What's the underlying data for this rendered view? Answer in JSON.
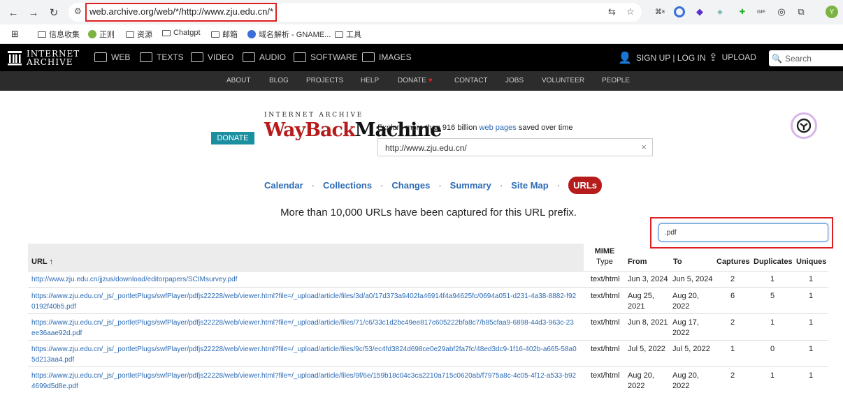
{
  "browser": {
    "url": "web.archive.org/web/*/http://www.zju.edu.cn/*",
    "profile_initial": "Y",
    "ext_badge": "8",
    "ext_gif": "GIF",
    "bookmarks": [
      "信息收集",
      "正则",
      "资源",
      "Chatgpt",
      "邮箱",
      "域名解析 - GNAME...",
      "工具"
    ]
  },
  "ia_nav": {
    "logo_line1": "INTERNET",
    "logo_line2": "ARCHIVE",
    "items": [
      "WEB",
      "TEXTS",
      "VIDEO",
      "AUDIO",
      "SOFTWARE",
      "IMAGES"
    ],
    "signup": "SIGN UP | LOG IN",
    "upload": "UPLOAD",
    "search_placeholder": "Search"
  },
  "ia_subnav": [
    "ABOUT",
    "BLOG",
    "PROJECTS",
    "HELP",
    "DONATE",
    "CONTACT",
    "JOBS",
    "VOLUNTEER",
    "PEOPLE"
  ],
  "wayback": {
    "donate_label": "DONATE",
    "logo_top": "INTERNET ARCHIVE",
    "logo_way": "WayBack",
    "logo_machine": "Machine",
    "explore_pre": "Explore more than 916 billion",
    "explore_link": "web pages",
    "explore_post": "saved over time",
    "search_value": "http://www.zju.edu.cn/",
    "clear": "×"
  },
  "tabs": [
    "Calendar",
    "Collections",
    "Changes",
    "Summary",
    "Site Map",
    "URLs"
  ],
  "tab_separator": "·",
  "summary_text": "More than 10,000 URLs have been captured for this URL prefix.",
  "filter_value": ".pdf",
  "table": {
    "headers": {
      "url": "URL ↑",
      "mime_line1": "MIME",
      "mime_line2": "Type",
      "from": "From",
      "to": "To",
      "captures": "Captures",
      "duplicates": "Duplicates",
      "uniques": "Uniques"
    },
    "rows": [
      {
        "url": "http://www.zju.edu.cn/jjzus/download/editorpapers/SCIMsurvey.pdf",
        "mime": "text/html",
        "from": "Jun 3, 2024",
        "to": "Jun 5, 2024",
        "captures": "2",
        "duplicates": "1",
        "uniques": "1"
      },
      {
        "url": "https://www.zju.edu.cn/_js/_portletPlugs/swfPlayer/pdfjs22228/web/viewer.html?file=/_upload/article/files/3d/a0/17d373a9402fa46914f4a94625fc/0694a051-d231-4a38-8882-f920192f40b5.pdf",
        "mime": "text/html",
        "from": "Aug 25, 2021",
        "to": "Aug 20, 2022",
        "captures": "6",
        "duplicates": "5",
        "uniques": "1"
      },
      {
        "url": "https://www.zju.edu.cn/_js/_portletPlugs/swfPlayer/pdfjs22228/web/viewer.html?file=/_upload/article/files/71/c6/33c1d2bc49ee817c605222bfa8c7/b85cfaa9-6898-44d3-963c-23ee36aae92d.pdf",
        "mime": "text/html",
        "from": "Jun 8, 2021",
        "to": "Aug 17, 2022",
        "captures": "2",
        "duplicates": "1",
        "uniques": "1"
      },
      {
        "url": "https://www.zju.edu.cn/_js/_portletPlugs/swfPlayer/pdfjs22228/web/viewer.html?file=/_upload/article/files/9c/53/ec4fd3824d698ce0e29abf2fa7fc/48ed3dc9-1f16-402b-a665-58a05d213aa4.pdf",
        "mime": "text/html",
        "from": "Jul 5, 2022",
        "to": "Jul 5, 2022",
        "captures": "1",
        "duplicates": "0",
        "uniques": "1"
      },
      {
        "url": "https://www.zju.edu.cn/_js/_portletPlugs/swfPlayer/pdfjs22228/web/viewer.html?file=/_upload/article/files/9f/6e/159b18c04c3ca2210a715c0620ab/f7975a8c-4c05-4f12-a533-b924699d5d8e.pdf",
        "mime": "text/html",
        "from": "Aug 20, 2022",
        "to": "Aug 20, 2022",
        "captures": "2",
        "duplicates": "1",
        "uniques": "1"
      }
    ]
  }
}
